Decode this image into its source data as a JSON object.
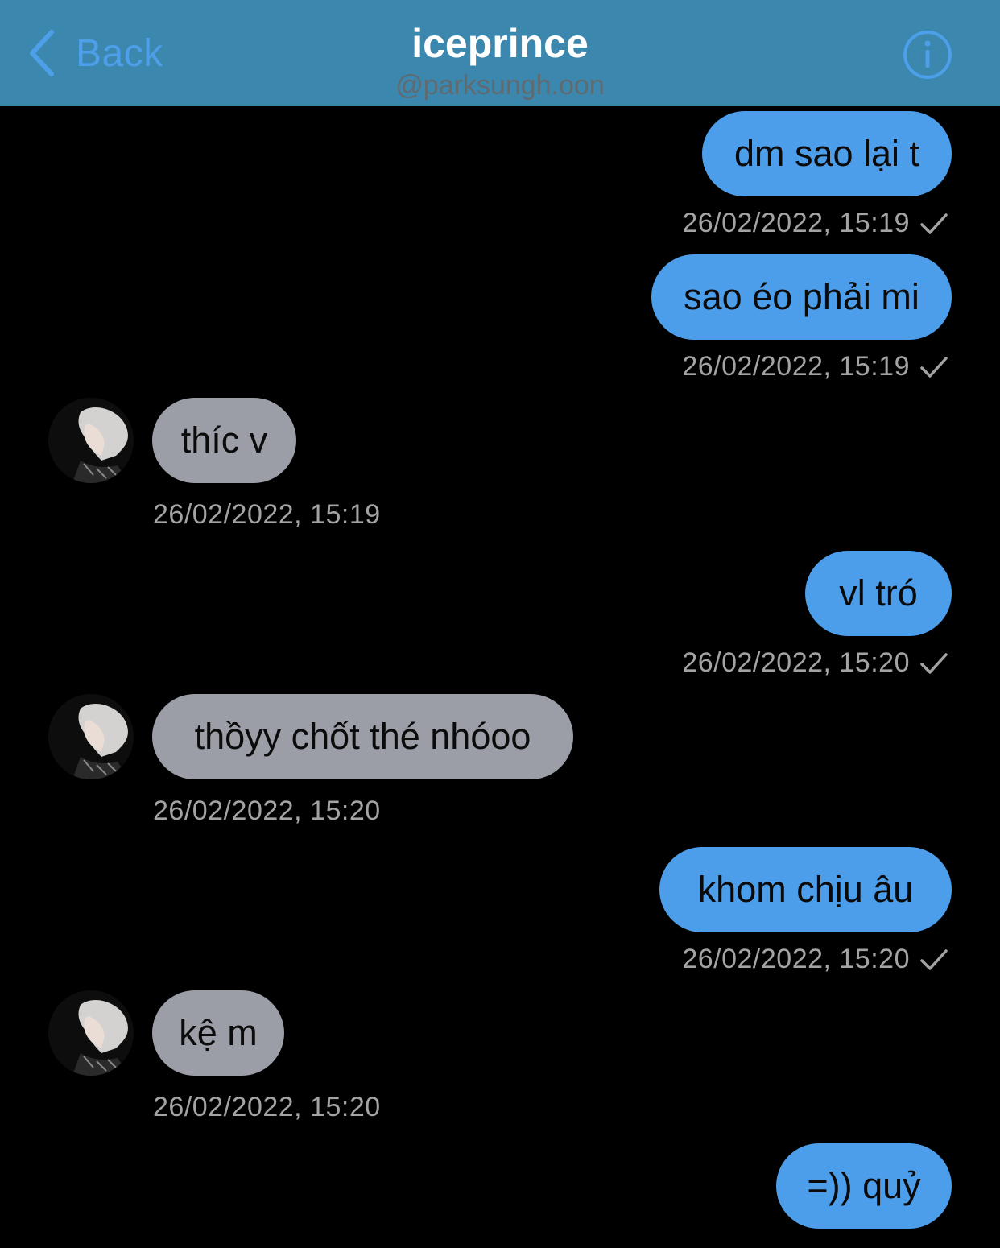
{
  "header": {
    "back_label": "Back",
    "title": "iceprince",
    "subtitle": "@parksungh.oon",
    "info_icon": "info-circle-icon"
  },
  "colors": {
    "header_bg": "#3c87ad",
    "accent": "#4d9fe9",
    "outgoing_bubble": "#4c9eea",
    "incoming_bubble": "#9b9ea7",
    "background": "#000000"
  },
  "messages": [
    {
      "direction": "out",
      "text": "dm sao lại t",
      "time": "26/02/2022, 15:19",
      "read_icon": "checkmark-icon"
    },
    {
      "direction": "out",
      "text": "sao éo phải mi",
      "time": "26/02/2022, 15:19",
      "read_icon": "checkmark-icon"
    },
    {
      "direction": "in",
      "text": "thíc v",
      "time": "26/02/2022, 15:19",
      "avatar_icon": "avatar"
    },
    {
      "direction": "out",
      "text": "vl tró",
      "time": "26/02/2022, 15:20",
      "read_icon": "checkmark-icon"
    },
    {
      "direction": "in",
      "text": "thồyy chốt thé nhóoo",
      "time": "26/02/2022, 15:20",
      "avatar_icon": "avatar"
    },
    {
      "direction": "out",
      "text": "khom chịu âu",
      "time": "26/02/2022, 15:20",
      "read_icon": "checkmark-icon"
    },
    {
      "direction": "in",
      "text": "kệ m",
      "time": "26/02/2022, 15:20",
      "avatar_icon": "avatar"
    },
    {
      "direction": "out",
      "text": "=)) quỷ",
      "time": "",
      "read_icon": ""
    }
  ]
}
